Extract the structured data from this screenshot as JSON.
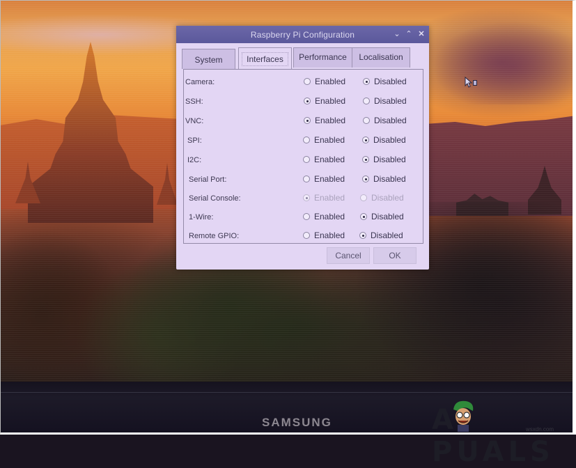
{
  "window": {
    "title": "Raspberry Pi Configuration",
    "controls": {
      "minimize": "⌄",
      "maximize": "⌃",
      "close": "✕"
    }
  },
  "tabs": [
    {
      "label": "System",
      "active": false
    },
    {
      "label": "Interfaces",
      "active": true
    },
    {
      "label": "Performance",
      "active": false
    },
    {
      "label": "Localisation",
      "active": false
    }
  ],
  "interfaces": [
    {
      "label": "Camera:",
      "enabled_label": "Enabled",
      "disabled_label": "Disabled",
      "value": "Disabled",
      "sensitive": true
    },
    {
      "label": "SSH:",
      "enabled_label": "Enabled",
      "disabled_label": "Disabled",
      "value": "Enabled",
      "sensitive": true
    },
    {
      "label": "VNC:",
      "enabled_label": "Enabled",
      "disabled_label": "Disabled",
      "value": "Enabled",
      "sensitive": true
    },
    {
      "label": "SPI:",
      "enabled_label": "Enabled",
      "disabled_label": "Disabled",
      "value": "Disabled",
      "sensitive": true
    },
    {
      "label": "I2C:",
      "enabled_label": "Enabled",
      "disabled_label": "Disabled",
      "value": "Disabled",
      "sensitive": true
    },
    {
      "label": "Serial Port:",
      "enabled_label": "Enabled",
      "disabled_label": "Disabled",
      "value": "Disabled",
      "sensitive": true
    },
    {
      "label": "Serial Console:",
      "enabled_label": "Enabled",
      "disabled_label": "Disabled",
      "value": "Enabled",
      "sensitive": false
    },
    {
      "label": "1-Wire:",
      "enabled_label": "Enabled",
      "disabled_label": "Disabled",
      "value": "Disabled",
      "sensitive": true
    },
    {
      "label": "Remote GPIO:",
      "enabled_label": "Enabled",
      "disabled_label": "Disabled",
      "value": "Disabled",
      "sensitive": true
    }
  ],
  "buttons": {
    "cancel": "Cancel",
    "ok": "OK"
  },
  "monitor": {
    "brand": "SAMSUNG"
  },
  "watermark": {
    "text": "A PUALS",
    "url": "wsxdn.com"
  },
  "colors": {
    "titlebar": "#5b589b",
    "dialog_bg": "#e3d6f4",
    "tab_inactive": "#cdbfe4"
  }
}
